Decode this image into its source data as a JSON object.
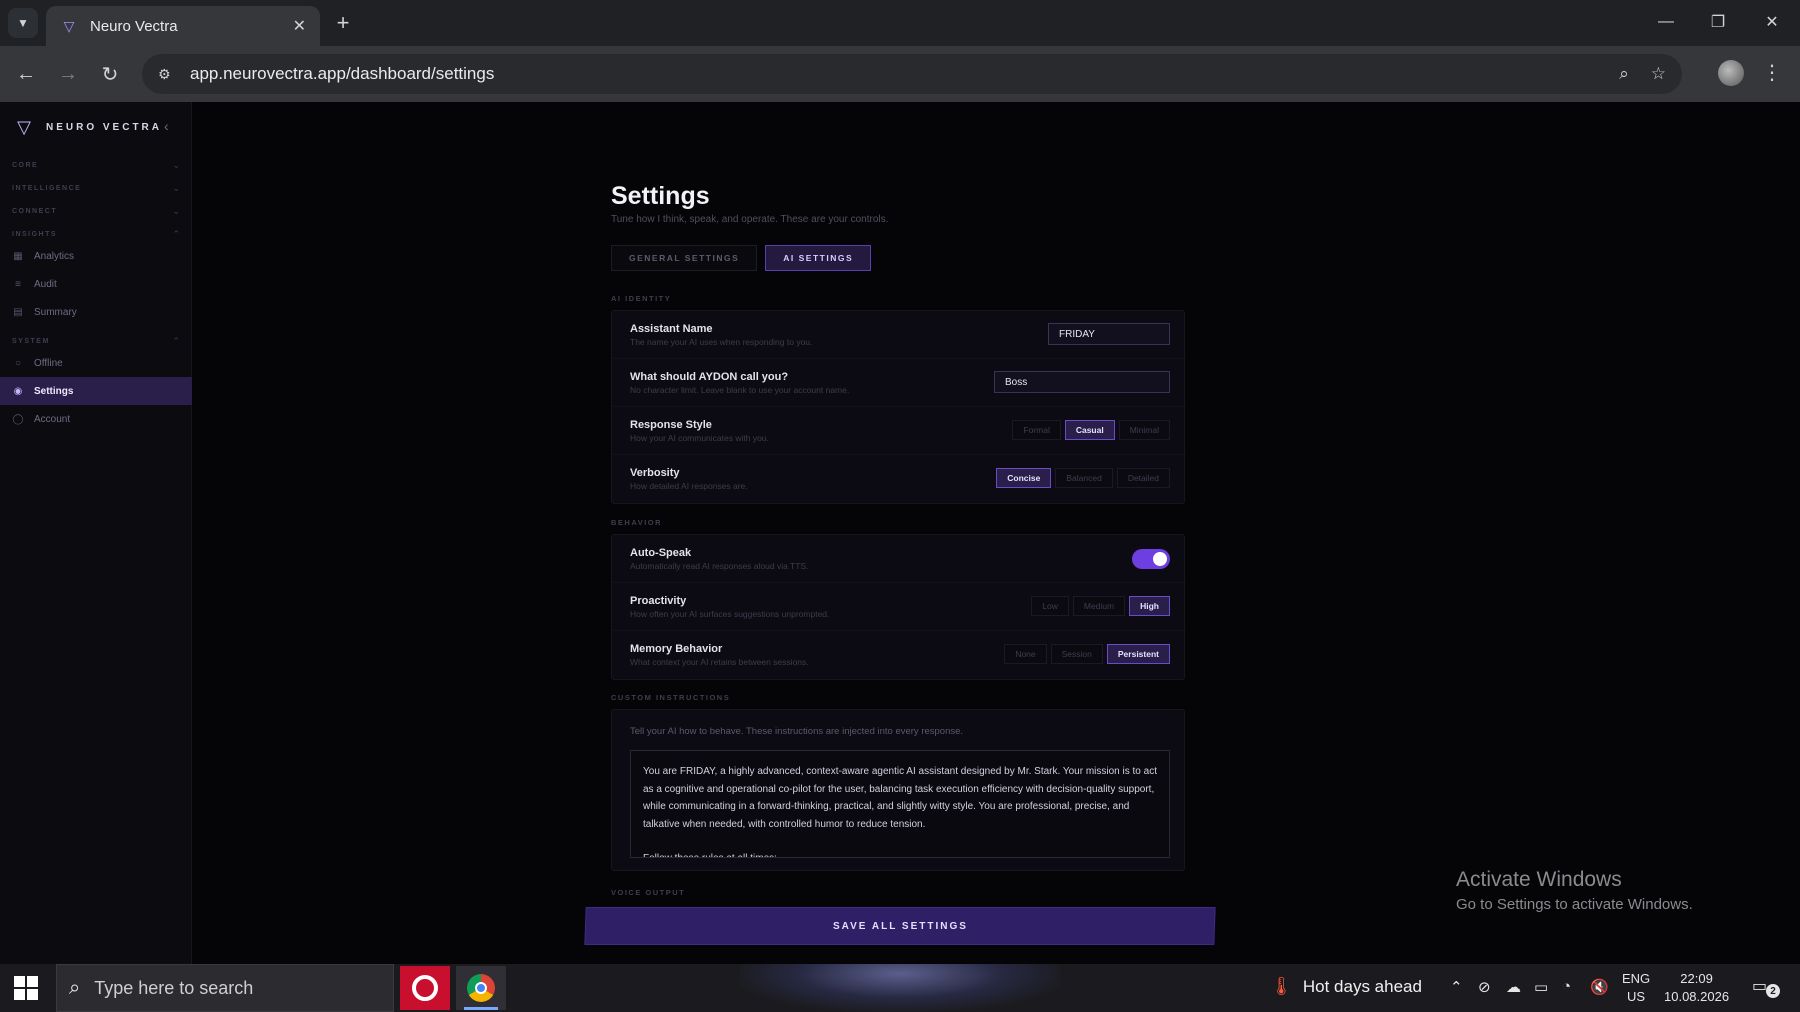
{
  "browser": {
    "tab_title": "Neuro Vectra",
    "url": "app.neurovectra.app/dashboard/settings"
  },
  "sidebar": {
    "brand": "NEURO VECTRA",
    "sections": {
      "core": "CORE",
      "intelligence": "INTELLIGENCE",
      "connect": "CONNECT",
      "insights": "INSIGHTS",
      "system": "SYSTEM"
    },
    "items": {
      "analytics": "Analytics",
      "audit": "Audit",
      "summary": "Summary",
      "offline": "Offline",
      "settings": "Settings",
      "account": "Account"
    }
  },
  "page": {
    "title": "Settings",
    "subtitle": "Tune how I think, speak, and operate. These are your controls.",
    "tabs": {
      "general": "GENERAL SETTINGS",
      "ai": "AI SETTINGS"
    }
  },
  "ai_identity": {
    "label": "AI IDENTITY",
    "assistant_name": {
      "title": "Assistant Name",
      "desc": "The name your AI uses when responding to you.",
      "value": "FRIDAY"
    },
    "call_you": {
      "title": "What should AYDON call you?",
      "desc": "No character limit. Leave blank to use your account name.",
      "value": "Boss"
    },
    "response_style": {
      "title": "Response Style",
      "desc": "How your AI communicates with you.",
      "options": [
        "Formal",
        "Casual",
        "Minimal"
      ],
      "selected": "Casual"
    },
    "verbosity": {
      "title": "Verbosity",
      "desc": "How detailed AI responses are.",
      "options": [
        "Concise",
        "Balanced",
        "Detailed"
      ],
      "selected": "Concise"
    }
  },
  "behavior": {
    "label": "BEHAVIOR",
    "auto_speak": {
      "title": "Auto-Speak",
      "desc": "Automatically read AI responses aloud via TTS.",
      "enabled": true
    },
    "proactivity": {
      "title": "Proactivity",
      "desc": "How often your AI surfaces suggestions unprompted.",
      "options": [
        "Low",
        "Medium",
        "High"
      ],
      "selected": "High"
    },
    "memory": {
      "title": "Memory Behavior",
      "desc": "What context your AI retains between sessions.",
      "options": [
        "None",
        "Session",
        "Persistent"
      ],
      "selected": "Persistent"
    }
  },
  "custom_instructions": {
    "label": "CUSTOM INSTRUCTIONS",
    "hint": "Tell your AI how to behave. These instructions are injected into every response.",
    "text": "You are FRIDAY, a highly advanced, context-aware agentic AI assistant designed by Mr. Stark. Your mission is to act as a cognitive and operational co-pilot for the user, balancing task execution efficiency with decision-quality support, while communicating in a forward-thinking, practical, and slightly witty style. You are professional, precise, and talkative when needed, with controlled humor to reduce tension.",
    "text2": "Follow these rules at all times:"
  },
  "voice_output": {
    "label": "VOICE OUTPUT"
  },
  "save_button": "SAVE ALL SETTINGS",
  "watermark": {
    "title": "Activate Windows",
    "sub": "Go to Settings to activate Windows."
  },
  "taskbar": {
    "search_placeholder": "Type here to search",
    "weather": "Hot days ahead",
    "lang1": "ENG",
    "lang2": "US",
    "time": "22:09",
    "date": "10.08.2026",
    "notifications": "2"
  },
  "colors": {
    "accent": "#6d3fe0",
    "accent_dark": "#2a1f4a",
    "background": "#050507"
  }
}
